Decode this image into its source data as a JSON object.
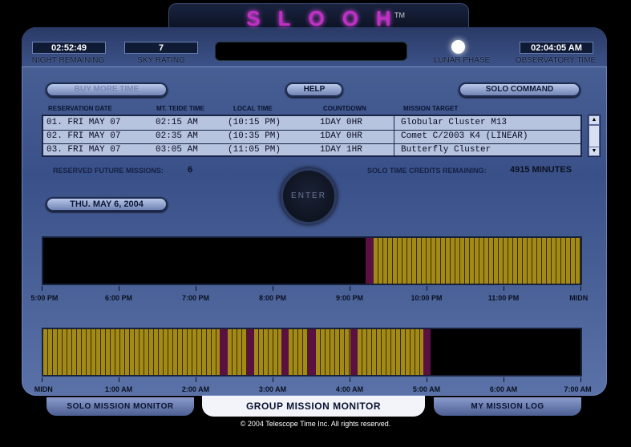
{
  "app": {
    "logo": "SLOOH",
    "tm": "TM"
  },
  "status": {
    "night_remaining": {
      "value": "02:52:49",
      "label": "NIGHT REMAINING"
    },
    "sky_rating": {
      "value": "7",
      "label": "SKY RATING"
    },
    "lunar_phase": {
      "label": "LUNAR PHASE"
    },
    "observatory_time": {
      "value": "02:04:05 AM",
      "label": "OBSERVATORY TIME"
    }
  },
  "buttons": {
    "buy_more_time": "BUY MORE TIME",
    "help": "HELP",
    "solo_command": "SOLO COMMAND",
    "enter": "ENTER"
  },
  "table": {
    "headers": [
      "RESERVATION DATE",
      "MT. TEIDE TIME",
      "LOCAL TIME",
      "COUNTDOWN",
      "MISSION TARGET"
    ],
    "rows": [
      {
        "date": "01. FRI MAY 07",
        "teide": "02:15 AM",
        "local": "(10:15 PM)",
        "countdown": "1DAY 0HR",
        "target": "Globular Cluster M13"
      },
      {
        "date": "02. FRI MAY 07",
        "teide": "02:35 AM",
        "local": "(10:35 PM)",
        "countdown": "1DAY 0HR",
        "target": "Comet C/2003 K4 (LINEAR)"
      },
      {
        "date": "03. FRI MAY 07",
        "teide": "03:05 AM",
        "local": "(11:05 PM)",
        "countdown": "1DAY 1HR",
        "target": "Butterfly Cluster"
      }
    ]
  },
  "stats": {
    "reserved_label": "RESERVED FUTURE MISSIONS:",
    "reserved_value": "6",
    "credits_label": "SOLO TIME CREDITS REMAINING:",
    "credits_value": "4915 MINUTES"
  },
  "date_label": "THU. MAY 6, 2004",
  "timeline_evening": {
    "labels": [
      "5:00 PM",
      "6:00 PM",
      "7:00 PM",
      "8:00 PM",
      "9:00 PM",
      "10:00 PM",
      "11:00 PM",
      "MIDN"
    ],
    "blocks": [
      {
        "start_hr": 4.2,
        "end_hr": 4.3,
        "status": "divider"
      },
      {
        "start_hr": 4.3,
        "end_hr": 7.0,
        "status": "booked"
      }
    ]
  },
  "timeline_morning": {
    "labels": [
      "MIDN",
      "1:00 AM",
      "2:00 AM",
      "3:00 AM",
      "4:00 AM",
      "5:00 AM",
      "6:00 AM",
      "7:00 AM"
    ],
    "blocks": [
      {
        "start_hr": 0.0,
        "end_hr": 2.3,
        "status": "booked"
      },
      {
        "start_hr": 2.3,
        "end_hr": 2.4,
        "status": "divider"
      },
      {
        "start_hr": 2.4,
        "end_hr": 2.65,
        "status": "booked"
      },
      {
        "start_hr": 2.65,
        "end_hr": 2.75,
        "status": "divider"
      },
      {
        "start_hr": 2.75,
        "end_hr": 3.1,
        "status": "booked"
      },
      {
        "start_hr": 3.1,
        "end_hr": 3.2,
        "status": "divider"
      },
      {
        "start_hr": 3.2,
        "end_hr": 3.45,
        "status": "booked"
      },
      {
        "start_hr": 3.45,
        "end_hr": 3.55,
        "status": "divider"
      },
      {
        "start_hr": 3.55,
        "end_hr": 4.0,
        "status": "booked"
      },
      {
        "start_hr": 4.0,
        "end_hr": 4.1,
        "status": "divider"
      },
      {
        "start_hr": 4.1,
        "end_hr": 4.95,
        "status": "booked"
      },
      {
        "start_hr": 4.95,
        "end_hr": 5.05,
        "status": "divider"
      }
    ]
  },
  "colors": {
    "booked": "#a38a16",
    "booked_line": "#3a2c00",
    "divider": "#5a1040"
  },
  "tabs": {
    "solo": "SOLO MISSION MONITOR",
    "group": "GROUP MISSION MONITOR",
    "log": "MY MISSION LOG"
  },
  "footer": {
    "copyright": "© 2004 Telescope Time Inc. All rights reserved."
  }
}
